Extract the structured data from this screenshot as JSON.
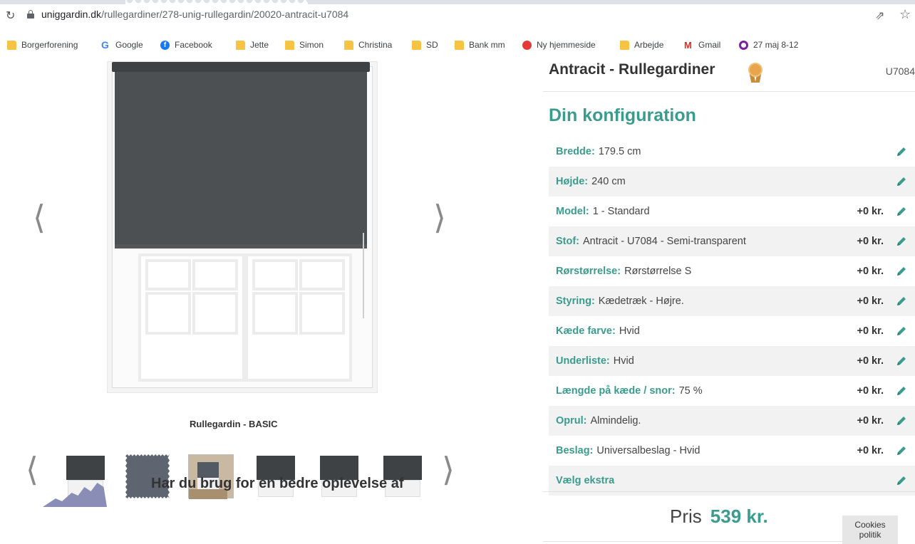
{
  "browser": {
    "url_domain": "uniggardin.dk",
    "url_path": "/rullegardiner/278-unig-rullegardin/20020-antracit-u7084",
    "icons": [
      "reload-icon",
      "lock-icon",
      "share-icon",
      "star-icon"
    ]
  },
  "bookmarks": [
    {
      "label": "Borgerforening",
      "icon": "folder-icon"
    },
    {
      "label": "Google",
      "icon": "google-icon"
    },
    {
      "label": "Facebook",
      "icon": "facebook-icon"
    },
    {
      "label": "Jette",
      "icon": "folder-icon"
    },
    {
      "label": "Simon",
      "icon": "folder-icon"
    },
    {
      "label": "Christina",
      "icon": "folder-icon"
    },
    {
      "label": "SD",
      "icon": "folder-icon"
    },
    {
      "label": "Bank mm",
      "icon": "folder-icon"
    },
    {
      "label": "Ny hjemmeside",
      "icon": "site-icon"
    },
    {
      "label": "Arbejde",
      "icon": "folder-icon"
    },
    {
      "label": "Gmail",
      "icon": "gmail-icon"
    },
    {
      "label": "27 maj 8-12",
      "icon": "calendar-icon"
    }
  ],
  "gallery": {
    "caption": "Rullegardin - BASIC",
    "prev_arrow": "⟨",
    "next_arrow": "⟩",
    "thumbnails": [
      "blind-thumbnail",
      "fabric-swatch-thumbnail",
      "photo-thumbnail",
      "blind-thumbnail",
      "blind-thumbnail",
      "blind-thumbnail"
    ],
    "promo_text": "Har du brug for en bedre oplevelse af"
  },
  "product": {
    "title": "Antracit - Rullegardiner",
    "sku": "U7084",
    "badge_icon": "medal-icon"
  },
  "config": {
    "heading": "Din konfiguration",
    "rows": [
      {
        "label": "Bredde:",
        "value": "179.5 cm",
        "price": ""
      },
      {
        "label": "Højde:",
        "value": "240 cm",
        "price": ""
      },
      {
        "label": "Model:",
        "value": "1 - Standard",
        "price": "+0 kr."
      },
      {
        "label": "Stof:",
        "value": "Antracit - U7084 - Semi-transparent",
        "price": "+0 kr."
      },
      {
        "label": "Rørstørrelse:",
        "value": "Rørstørrelse S",
        "price": "+0 kr."
      },
      {
        "label": "Styring:",
        "value": "Kædetræk - Højre.",
        "price": "+0 kr."
      },
      {
        "label": "Kæde farve:",
        "value": "Hvid",
        "price": "+0 kr."
      },
      {
        "label": "Underliste:",
        "value": "Hvid",
        "price": "+0 kr."
      },
      {
        "label": "Længde på kæde / snor:",
        "value": "75 %",
        "price": "+0 kr."
      },
      {
        "label": "Oprul:",
        "value": "Almindelig.",
        "price": "+0 kr."
      },
      {
        "label": "Beslag:",
        "value": "Universalbeslag - Hvid",
        "price": "+0 kr."
      },
      {
        "label": "Vælg ekstra",
        "value": "",
        "price": ""
      }
    ]
  },
  "price": {
    "label": "Pris",
    "amount": "539 kr."
  },
  "cookies": {
    "line1": "Cookies",
    "line2": "politik"
  },
  "colors": {
    "accent": "#3a9c8d",
    "blind": "#4d5053",
    "row_alt": "#f2f2f2"
  }
}
